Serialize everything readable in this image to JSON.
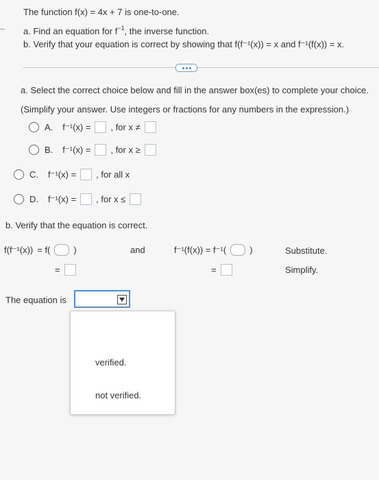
{
  "header": {
    "intro": "The function f(x) = 4x + 7 is one-to-one.",
    "part_a_prefix": "a. Find an equation for f",
    "part_a_sup": "−1",
    "part_a_suffix": ", the inverse function.",
    "part_b": "b. Verify that your equation is correct by showing that f(f⁻¹(x)) = x and f⁻¹(f(x)) = x."
  },
  "part_a": {
    "instruction": "a. Select the correct choice below and fill in the answer box(es) to complete your choice.",
    "simplify_note": "(Simplify your answer. Use integers or fractions for any numbers in the expression.)",
    "choices": [
      {
        "letter": "A.",
        "lhs": "f⁻¹(x) =",
        "cond": ", for x ≠"
      },
      {
        "letter": "B.",
        "lhs": "f⁻¹(x) =",
        "cond": ", for x ≥"
      },
      {
        "letter": "C.",
        "lhs": "f⁻¹(x) =",
        "cond": ", for all x"
      },
      {
        "letter": "D.",
        "lhs": "f⁻¹(x) =",
        "cond": ", for x ≤"
      }
    ]
  },
  "part_b": {
    "title": "b. Verify that the equation is correct.",
    "left_eq": "f(f⁻¹(x))",
    "left_rhs": "= f(",
    "and": "and",
    "right_eq": "f⁻¹(f(x)) = f⁻¹(",
    "equals": "=",
    "substitute": "Substitute.",
    "simplify": "Simplify."
  },
  "conclusion": {
    "label": "The equation is",
    "options": [
      "verified.",
      "not verified."
    ]
  }
}
